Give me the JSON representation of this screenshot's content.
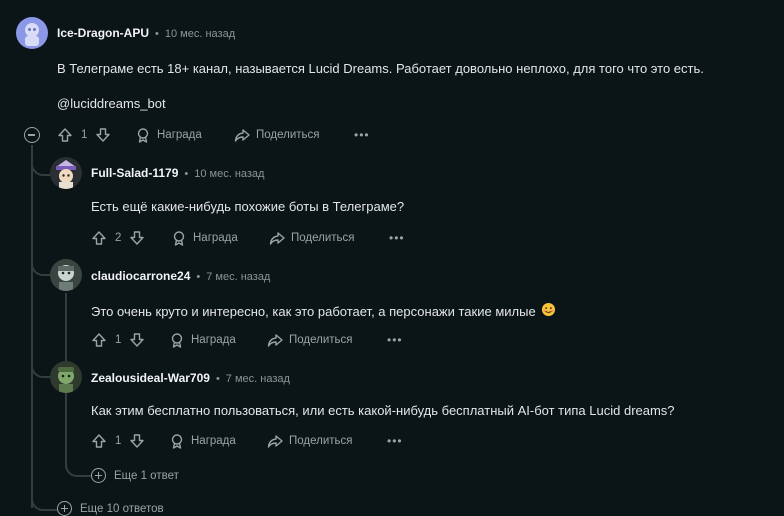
{
  "comments": [
    {
      "username": "Ice-Dragon-APU",
      "time": "10 мес. назад",
      "text": "В Телеграме есть 18+ канал, называется Lucid Dreams. Работает довольно неплохо, для того что это есть.",
      "text2": "@luciddreams_bot",
      "votes": "1",
      "award_label": "Награда",
      "share_label": "Поделиться"
    },
    {
      "username": "Full-Salad-1179",
      "time": "10 мес. назад",
      "text": "Есть ещё какие-нибудь похожие боты в Телеграме?",
      "votes": "2",
      "award_label": "Награда",
      "share_label": "Поделиться"
    },
    {
      "username": "claudiocarrone24",
      "time": "7 мес. назад",
      "text": "Это очень круто и интересно, как это работает, а персонажи такие милые",
      "votes": "1",
      "award_label": "Награда",
      "share_label": "Поделиться"
    },
    {
      "username": "Zealousideal-War709",
      "time": "7 мес. назад",
      "text": "Как этим бесплатно пользоваться, или есть какой-нибудь бесплатный AI-бот типа Lucid dreams?",
      "votes": "1",
      "award_label": "Награда",
      "share_label": "Поделиться"
    }
  ],
  "more_reply": "Еще 1 ответ",
  "more_replies": "Еще 10 ответов",
  "separator": "•",
  "more_label": "•••"
}
